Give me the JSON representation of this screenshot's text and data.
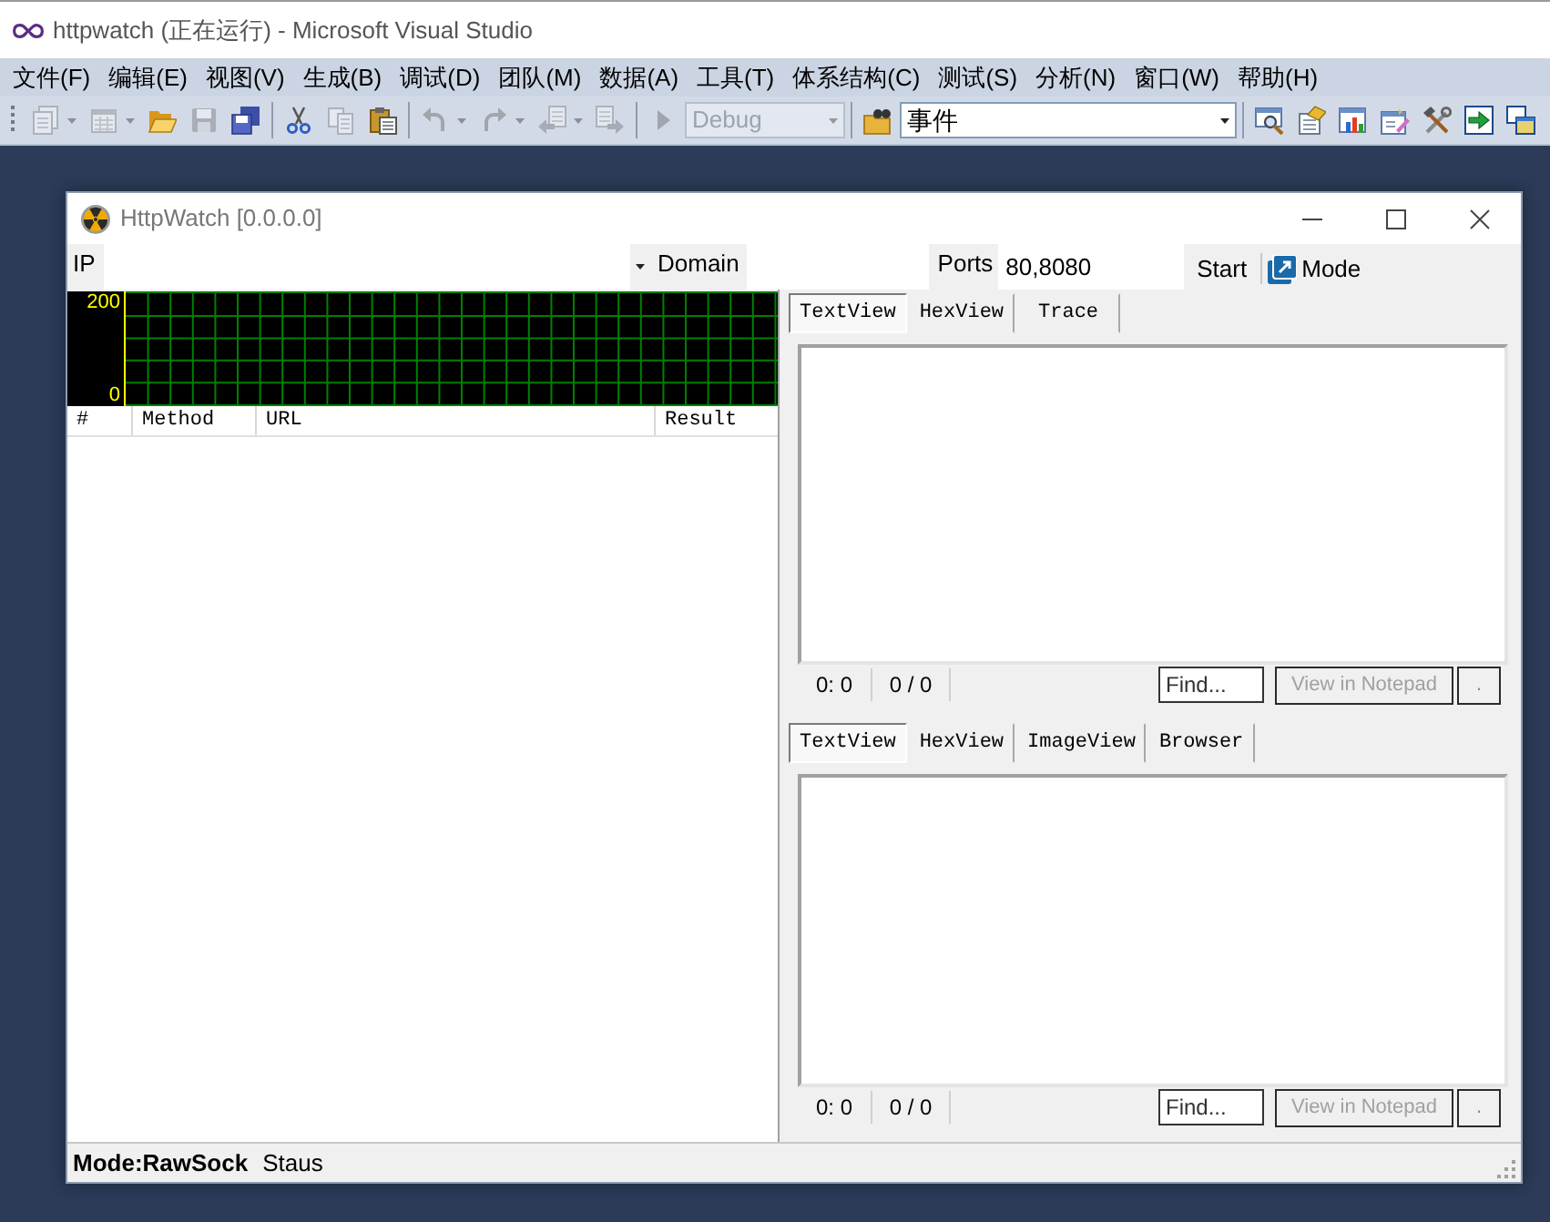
{
  "window": {
    "title": "httpwatch (正在运行) - Microsoft Visual Studio"
  },
  "menu": [
    "文件(F)",
    "编辑(E)",
    "视图(V)",
    "生成(B)",
    "调试(D)",
    "团队(M)",
    "数据(A)",
    "工具(T)",
    "体系结构(C)",
    "测试(S)",
    "分析(N)",
    "窗口(W)",
    "帮助(H)"
  ],
  "toolbar": {
    "groups": [
      {
        "items": [
          {
            "kind": "new-project",
            "disabled": true,
            "dropdown": true
          },
          {
            "kind": "add-item",
            "disabled": true,
            "dropdown": true
          },
          {
            "kind": "open",
            "disabled": false,
            "dropdown": false
          },
          {
            "kind": "save",
            "disabled": true,
            "dropdown": false
          },
          {
            "kind": "save-all",
            "disabled": false,
            "dropdown": false
          }
        ]
      },
      {
        "items": [
          {
            "kind": "cut",
            "disabled": false,
            "dropdown": false
          },
          {
            "kind": "copy",
            "disabled": true,
            "dropdown": false
          },
          {
            "kind": "paste",
            "disabled": false,
            "dropdown": false
          }
        ]
      },
      {
        "items": [
          {
            "kind": "undo",
            "disabled": true,
            "dropdown": true
          },
          {
            "kind": "redo",
            "disabled": true,
            "dropdown": true
          },
          {
            "kind": "navigate-back",
            "disabled": true,
            "dropdown": true
          },
          {
            "kind": "navigate-forward",
            "disabled": true,
            "dropdown": false
          }
        ]
      },
      {
        "items": [
          {
            "kind": "start",
            "disabled": true,
            "dropdown": false
          },
          {
            "kind": "configuration",
            "value": "Debug",
            "disabled": true,
            "dropdown": true
          }
        ]
      },
      {
        "items": [
          {
            "kind": "find-in-files",
            "disabled": false,
            "dropdown": false
          },
          {
            "kind": "find",
            "value": "事件",
            "disabled": false,
            "dropdown": true
          }
        ]
      },
      {
        "items": [
          {
            "kind": "window-magnifier",
            "disabled": false,
            "dropdown": false
          },
          {
            "kind": "document-tag",
            "disabled": false,
            "dropdown": false
          },
          {
            "kind": "chart-window",
            "disabled": false,
            "dropdown": false
          },
          {
            "kind": "document-pencil",
            "disabled": false,
            "dropdown": false
          },
          {
            "kind": "tools",
            "disabled": false,
            "dropdown": false
          },
          {
            "kind": "arrow-box",
            "disabled": false,
            "dropdown": false
          },
          {
            "kind": "windows",
            "disabled": false,
            "dropdown": false
          }
        ]
      }
    ]
  },
  "httpwatch": {
    "title": "HttpWatch [0.0.0.0]",
    "filters": {
      "ip": {
        "label": "IP"
      },
      "domain": {
        "label": "Domain"
      },
      "ports": {
        "label": "Ports",
        "value": "80,8080"
      }
    },
    "start_button": "Start",
    "mode_button": "Mode",
    "traffic_graph": {
      "y_max": "200",
      "y_min": "0"
    },
    "requests": {
      "columns": [
        "#",
        "Method",
        "URL",
        "Result"
      ]
    },
    "request_panel": {
      "tabs": [
        {
          "label": "TextView",
          "selected": true
        },
        {
          "label": "HexView",
          "selected": false
        },
        {
          "label": "Trace",
          "selected": false
        }
      ],
      "position": "0: 0",
      "match": "0 / 0",
      "find": {
        "placeholder": "Find..."
      },
      "notepad_button": {
        "label": "View in Notepad",
        "disabled": true
      },
      "more_button": "."
    },
    "response_panel": {
      "tabs": [
        {
          "label": "TextView",
          "selected": true
        },
        {
          "label": "HexView",
          "selected": false
        },
        {
          "label": "ImageView",
          "selected": false
        },
        {
          "label": "Browser",
          "selected": false
        }
      ],
      "position": "0: 0",
      "match": "0 / 0",
      "find": {
        "placeholder": "Find..."
      },
      "notepad_button": {
        "label": "View in Notepad",
        "disabled": true
      },
      "more_button": "."
    },
    "status_bar": {
      "mode": "Mode:RawSock",
      "status": "Staus"
    }
  }
}
